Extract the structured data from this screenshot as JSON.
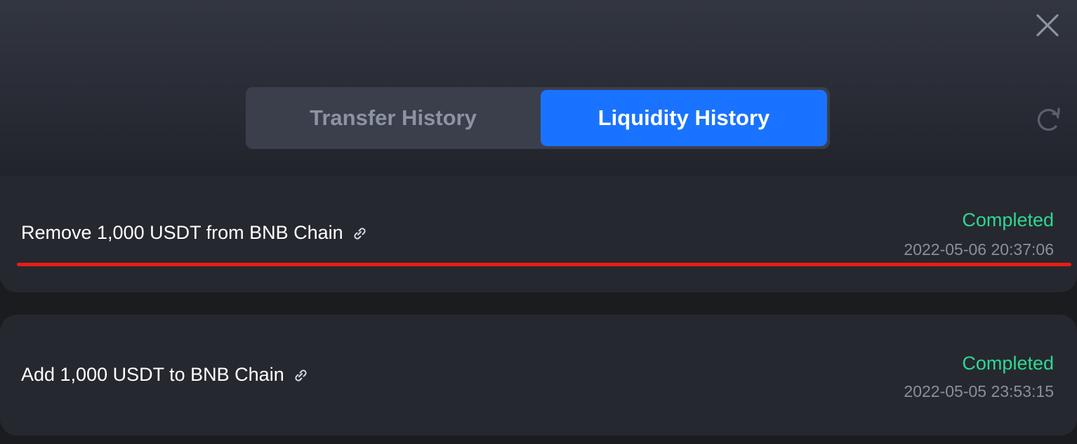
{
  "tabs": {
    "transfer_label": "Transfer History",
    "liquidity_label": "Liquidity History",
    "active": "liquidity"
  },
  "icons": {
    "close": "close-icon",
    "refresh": "refresh-icon",
    "link": "link-icon"
  },
  "colors": {
    "accent": "#1a73ff",
    "status_completed": "#2ed890",
    "highlight_line": "#ea1c12"
  },
  "history": [
    {
      "title": "Remove 1,000 USDT from BNB Chain",
      "status": "Completed",
      "timestamp": "2022-05-06 20:37:06"
    },
    {
      "title": "Add 1,000 USDT to BNB Chain",
      "status": "Completed",
      "timestamp": "2022-05-05 23:53:15"
    }
  ]
}
